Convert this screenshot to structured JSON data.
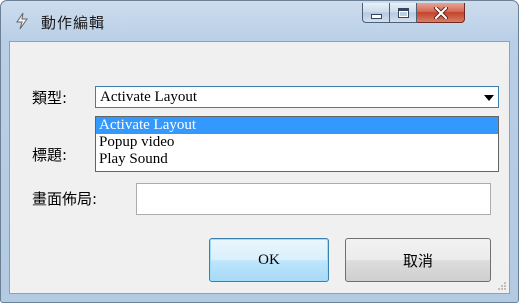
{
  "window": {
    "title": "動作編輯"
  },
  "form": {
    "type_label": "類型:",
    "type_value": "Activate Layout",
    "type_options": [
      "Activate Layout",
      "Popup video",
      "Play Sound"
    ],
    "title_label": "標題:",
    "layout_label": "畫面佈局:",
    "layout_value": ""
  },
  "buttons": {
    "ok": "OK",
    "cancel": "取消"
  },
  "colors": {
    "selection": "#3399ff",
    "close_button": "#c4442b",
    "focus_border": "#3c7fb1"
  }
}
